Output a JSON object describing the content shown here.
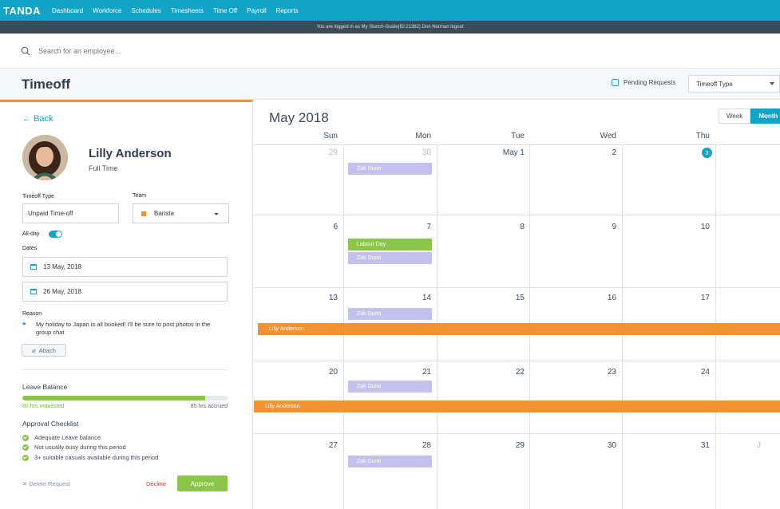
{
  "nav": {
    "brand": "TANDA",
    "items": [
      "Dashboard",
      "Workforce",
      "Schedules",
      "Timesheets",
      "Time Off",
      "Payroll",
      "Reports"
    ],
    "accent_color": "#13a3c4"
  },
  "login_bar": {
    "text": "You are logged in as My Sketch-Guide(ID:21382) Don Norman logout"
  },
  "search": {
    "placeholder": "Search for an employee..."
  },
  "header": {
    "title": "Timeoff",
    "pending_label": "Pending Requests",
    "timeoff_type_select": "Timeoff Type"
  },
  "request": {
    "back_label": "Back",
    "employee_name": "Lilly Anderson",
    "employee_type": "Full Time",
    "timeoff_type_label": "Timeoff Type",
    "timeoff_type_value": "Unpaid Time-off",
    "team_label": "Team",
    "team_value": "Barista",
    "team_color": "#f39233",
    "allday_label": "All-day",
    "allday_on": true,
    "dates_label": "Dates",
    "start_date": "13 May, 2018",
    "end_date": "26 May, 2018",
    "reason_label": "Reason",
    "reason_text": "My holiday to Japan is all booked! I'll be sure to post photos in the group chat",
    "attach_label": "Attach",
    "leave_balance_label": "Leave Balance",
    "requested_text": "80 hrs requested",
    "accrued_text": "85 hrs accrued",
    "progress_fraction": 0.89,
    "checklist_label": "Approval Checklist",
    "checklist": [
      "Adequate Leave balance",
      "Not usually busy during this period",
      "3+ suitable casuals available during this period"
    ],
    "delete_label": "Delete Request",
    "decline_label": "Decline",
    "approve_label": "Approve"
  },
  "calendar": {
    "month": "May",
    "year": "2018",
    "views": [
      "Week",
      "Month"
    ],
    "active_view": "Month",
    "weekdays": [
      "Sun",
      "Mon",
      "Tue",
      "Wed",
      "Thu"
    ],
    "weeks": [
      [
        "29",
        "30",
        "May 1",
        "2",
        "3"
      ],
      [
        "6",
        "7",
        "8",
        "9",
        "10"
      ],
      [
        "13",
        "14",
        "15",
        "16",
        "17"
      ],
      [
        "20",
        "21",
        "22",
        "23",
        "24"
      ],
      [
        "27",
        "28",
        "29",
        "30",
        "31"
      ]
    ],
    "week6_partial": "J",
    "events": {
      "zak": "Zak Dunn",
      "labour": "Labour Day",
      "lilly": "Lilly Anderson"
    }
  }
}
